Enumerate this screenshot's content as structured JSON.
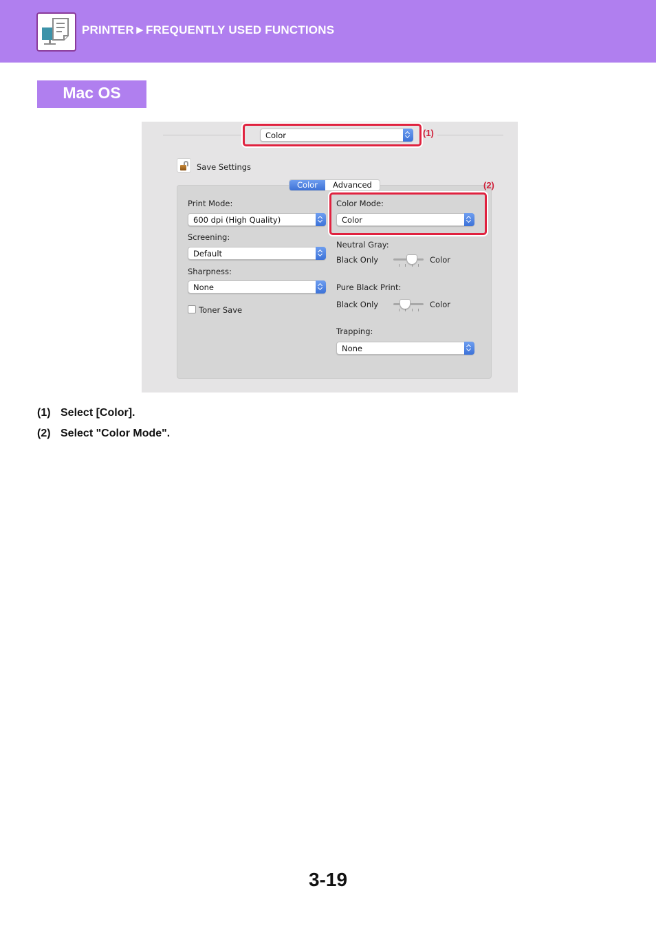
{
  "header": {
    "icon": "printer-document-icon",
    "title": "PRINTER►FREQUENTLY USED FUNCTIONS",
    "background_color": "#b07fef"
  },
  "section": {
    "label": "Mac OS"
  },
  "dialog": {
    "panel_popup": {
      "value": "Color"
    },
    "callouts": [
      "(1)",
      "(2)"
    ],
    "save_settings": {
      "label": "Save Settings",
      "icon": "unlocked-padlock-icon"
    },
    "tabs": [
      {
        "label": "Color",
        "active": true
      },
      {
        "label": "Advanced",
        "active": false
      }
    ],
    "left_column": {
      "print_mode": {
        "label": "Print Mode:",
        "value": "600 dpi (High Quality)"
      },
      "screening": {
        "label": "Screening:",
        "value": "Default"
      },
      "sharpness": {
        "label": "Sharpness:",
        "value": "None"
      },
      "toner_save": {
        "label": "Toner Save",
        "checked": false
      }
    },
    "right_column": {
      "color_mode": {
        "label": "Color Mode:",
        "value": "Color"
      },
      "neutral_gray": {
        "label": "Neutral Gray:",
        "min_label": "Black Only",
        "max_label": "Color",
        "steps": 4,
        "position": 3
      },
      "pure_black_print": {
        "label": "Pure Black Print:",
        "min_label": "Black Only",
        "max_label": "Color",
        "steps": 4,
        "position": 2
      },
      "trapping": {
        "label": "Trapping:",
        "value": "None"
      }
    },
    "highlight_color": "#e0223f"
  },
  "steps": [
    {
      "number": "(1)",
      "text": "Select [Color]."
    },
    {
      "number": "(2)",
      "text": "Select \"Color Mode\"."
    }
  ],
  "page_number": "3-19"
}
